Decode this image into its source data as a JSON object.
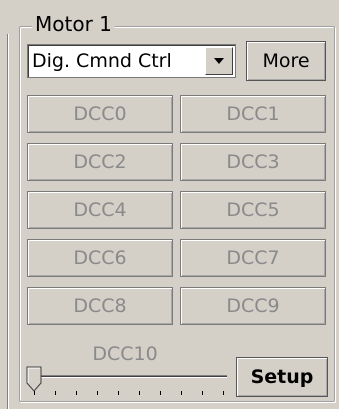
{
  "group": {
    "title": "Motor 1"
  },
  "command_select": {
    "value": "Dig. Cmnd Ctrl"
  },
  "more_button": {
    "label": "More"
  },
  "dcc_buttons": [
    "DCC0",
    "DCC1",
    "DCC2",
    "DCC3",
    "DCC4",
    "DCC5",
    "DCC6",
    "DCC7",
    "DCC8",
    "DCC9"
  ],
  "slider": {
    "label": "DCC10",
    "value_fraction": 0
  },
  "setup_button": {
    "label": "Setup"
  },
  "icons": {
    "dropdown": "chevron-down-icon"
  }
}
